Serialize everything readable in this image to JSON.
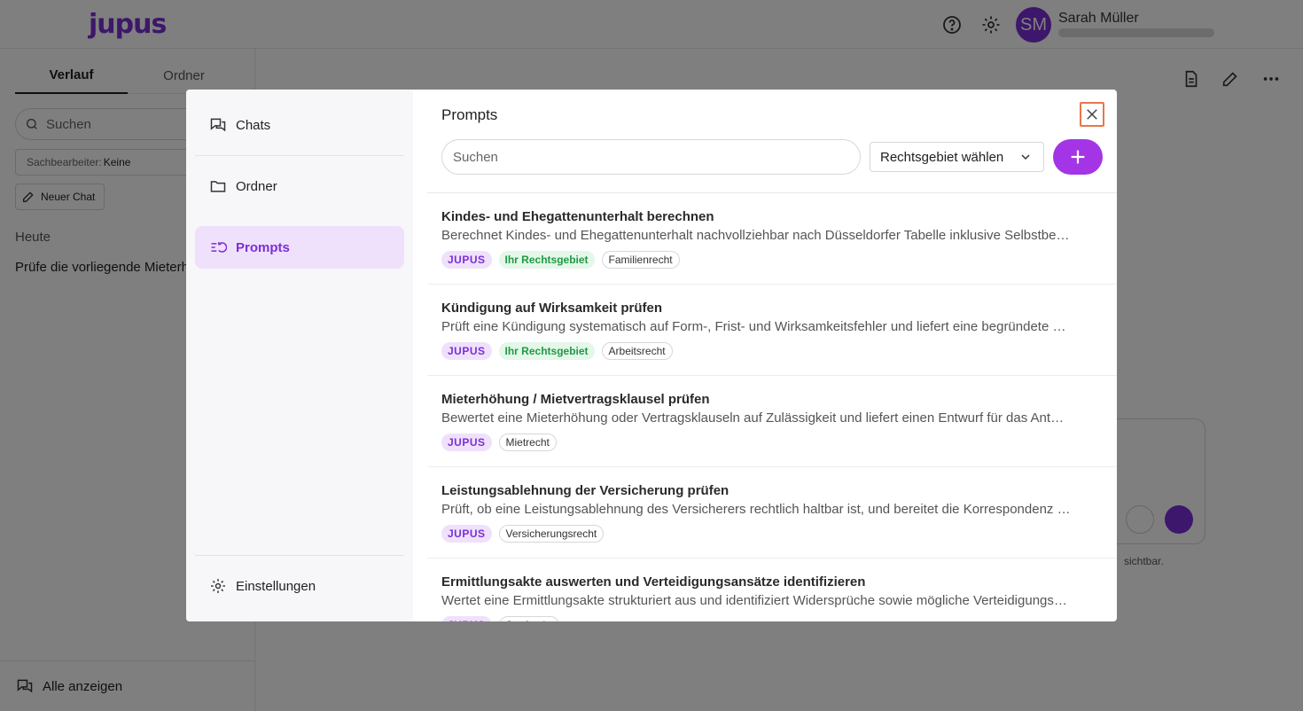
{
  "app": {
    "logo": "jupus",
    "user": {
      "initials": "SM",
      "name": "Sarah Müller"
    }
  },
  "background": {
    "tabs": [
      "Verlauf",
      "Ordner"
    ],
    "search_placeholder": "Suchen",
    "filter_label": "Sachbearbeiter:",
    "filter_value": "Keine",
    "new_chat": "Neuer Chat",
    "today": "Heute",
    "recent_chat": "Prüfe die vorliegende Mieterhöhung",
    "show_all": "Alle anzeigen",
    "hint": "sichtbar."
  },
  "modal": {
    "nav": [
      {
        "label": "Chats",
        "icon": "chats-icon"
      },
      {
        "label": "Ordner",
        "icon": "folder-icon"
      },
      {
        "label": "Prompts",
        "icon": "prompts-icon"
      }
    ],
    "settings": "Einstellungen",
    "title": "Prompts",
    "search_placeholder": "Suchen",
    "area_select": "Rechtsgebiet wählen",
    "prompts": [
      {
        "title": "Kindes- und Ehegattenunterhalt berechnen",
        "description": "Berechnet Kindes- und Ehegattenunterhalt nachvollziehbar nach Düsseldorfer Tabelle inklusive Selbstbehalt und Mangelfallberechnung",
        "tags": [
          {
            "label": "JUPUS",
            "kind": "jupus"
          },
          {
            "label": "Ihr Rechtsgebiet",
            "kind": "area"
          },
          {
            "label": "Familienrecht",
            "kind": "law"
          }
        ]
      },
      {
        "title": "Kündigung auf Wirksamkeit prüfen",
        "description": "Prüft eine Kündigung systematisch auf Form-, Frist- und Wirksamkeitsfehler und liefert eine begründete Einschätzung",
        "tags": [
          {
            "label": "JUPUS",
            "kind": "jupus"
          },
          {
            "label": "Ihr Rechtsgebiet",
            "kind": "area"
          },
          {
            "label": "Arbeitsrecht",
            "kind": "law"
          }
        ]
      },
      {
        "title": "Mieterhöhung / Mietvertragsklausel prüfen",
        "description": "Bewertet eine Mieterhöhung oder Vertragsklauseln auf Zulässigkeit und liefert einen Entwurf für das Antwortschreiben an den Vermieter",
        "tags": [
          {
            "label": "JUPUS",
            "kind": "jupus"
          },
          {
            "label": "Mietrecht",
            "kind": "law"
          }
        ]
      },
      {
        "title": "Leistungsablehnung der Versicherung prüfen",
        "description": "Prüft, ob eine Leistungsablehnung des Versicherers rechtlich haltbar ist, und bereitet die Korrespondenz vor",
        "tags": [
          {
            "label": "JUPUS",
            "kind": "jupus"
          },
          {
            "label": "Versicherungsrecht",
            "kind": "law"
          }
        ]
      },
      {
        "title": "Ermittlungsakte auswerten und Verteidigungsansätze identifizieren",
        "description": "Wertet eine Ermittlungsakte strukturiert aus und identifiziert Widersprüche sowie mögliche Verteidigungsansätze",
        "tags": [
          {
            "label": "JUPUS",
            "kind": "jupus"
          },
          {
            "label": "Strafrecht",
            "kind": "law"
          }
        ]
      }
    ]
  },
  "colors": {
    "accent": "#a335e6",
    "brand": "#7b2fd6",
    "area_green": "#1f9a45",
    "close_outline": "#e8764a"
  }
}
